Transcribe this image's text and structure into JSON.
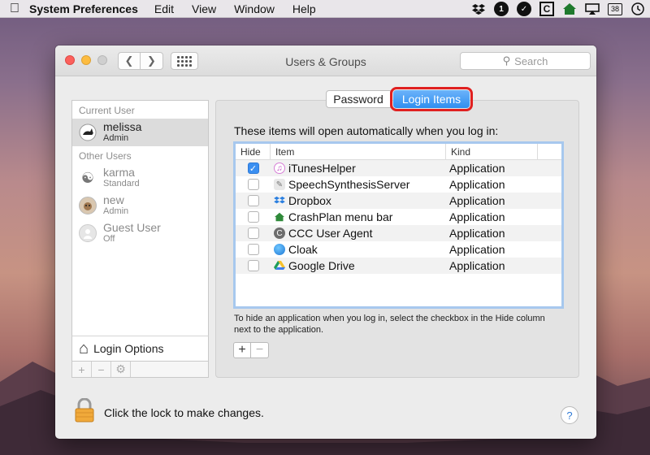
{
  "menubar": {
    "app_name": "System Preferences",
    "menus": [
      "Edit",
      "View",
      "Window",
      "Help"
    ],
    "status_icons": [
      "dropbox-icon",
      "onepassword-icon",
      "check-circle-icon",
      "ccc-icon",
      "crashplan-icon",
      "airplay-icon",
      "calendar-icon",
      "time-machine-icon"
    ],
    "calendar_badge": "38"
  },
  "window": {
    "title": "Users & Groups",
    "search_placeholder": "Search"
  },
  "sidebar": {
    "current_user_label": "Current User",
    "other_users_label": "Other Users",
    "current_user": {
      "name": "melissa",
      "role": "Admin"
    },
    "other_users": [
      {
        "name": "karma",
        "role": "Standard"
      },
      {
        "name": "new",
        "role": "Admin"
      },
      {
        "name": "Guest User",
        "role": "Off"
      }
    ],
    "login_options": "Login Options"
  },
  "tabs": {
    "password": "Password",
    "login_items": "Login Items",
    "active": "login_items",
    "highlight_color": "#e02020"
  },
  "login_items": {
    "intro": "These items will open automatically when you log in:",
    "columns": {
      "hide": "Hide",
      "item": "Item",
      "kind": "Kind"
    },
    "rows": [
      {
        "hide": true,
        "name": "iTunesHelper",
        "kind": "Application",
        "icon": "itunes-icon"
      },
      {
        "hide": false,
        "name": "SpeechSynthesisServer",
        "kind": "Application",
        "icon": "speech-icon"
      },
      {
        "hide": false,
        "name": "Dropbox",
        "kind": "Application",
        "icon": "dropbox-icon"
      },
      {
        "hide": false,
        "name": "CrashPlan menu bar",
        "kind": "Application",
        "icon": "crashplan-icon"
      },
      {
        "hide": false,
        "name": "CCC User Agent",
        "kind": "Application",
        "icon": "ccc-icon"
      },
      {
        "hide": false,
        "name": "Cloak",
        "kind": "Application",
        "icon": "cloak-icon"
      },
      {
        "hide": false,
        "name": "Google Drive",
        "kind": "Application",
        "icon": "google-drive-icon"
      }
    ],
    "hint": "To hide an application when you log in, select the checkbox in the Hide column next to the application."
  },
  "footer": {
    "lock_text": "Click the lock to make changes.",
    "help": "?"
  }
}
